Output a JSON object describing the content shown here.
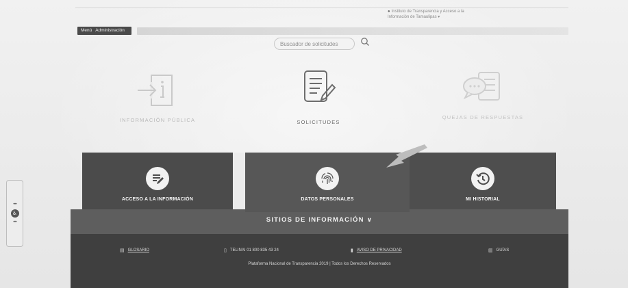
{
  "header": {
    "institute_line1": "Instituto de Transparencia y Acceso a la",
    "institute_line2": "Información de Tamaulipas",
    "institute_caret": "▾",
    "menu_label": "Menú",
    "admin_label": "Administración"
  },
  "search": {
    "placeholder": "Buscador de solicitudes",
    "icon": "search-icon"
  },
  "top_nav": [
    {
      "label": "INFORMACIÓN PÚBLICA",
      "icon": "info-document-icon"
    },
    {
      "label": "SOLICITUDES",
      "icon": "document-pencil-icon"
    },
    {
      "label": "QUEJAS DE RESPUESTAS",
      "icon": "chat-document-icon"
    }
  ],
  "cards": [
    {
      "label": "ACCESO A LA INFORMACIÓN",
      "icon": "edit-list-icon"
    },
    {
      "label": "DATOS PERSONALES",
      "icon": "fingerprint-icon"
    },
    {
      "label": "MI HISTORIAL",
      "icon": "history-clock-icon"
    }
  ],
  "sitios": {
    "label": "SITIOS DE INFORMACIÓN",
    "chevron": "∨"
  },
  "footer": {
    "links": [
      {
        "label": "GLOSARIO",
        "icon": "book-icon"
      },
      {
        "label": "TELINAI 01 800 835 43 24",
        "icon": "phone-icon"
      },
      {
        "label": "AVISO DE PRIVACIDAD",
        "icon": "info-icon"
      },
      {
        "label": "GUÍAS",
        "icon": "guide-icon"
      }
    ],
    "copyright": "Plataforma Nacional de Transparencia 2019 | Todos los Derechos Reservados"
  },
  "accessibility": {
    "icon": "accessibility-icon",
    "symbol": "♿"
  },
  "colors": {
    "background": "#e9e9e9",
    "card_dark": "#4b4b4b",
    "band": "#5e5e5e",
    "footer": "#3f3f3f"
  }
}
